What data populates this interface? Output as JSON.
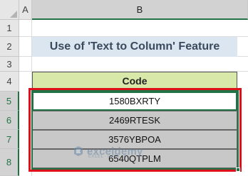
{
  "columns": [
    "A",
    "B"
  ],
  "rows": [
    "1",
    "2",
    "3",
    "4",
    "5",
    "6",
    "7",
    "8"
  ],
  "title": "Use of 'Text to Column' Feature",
  "table": {
    "header": "Code",
    "cells": [
      "1580BXRTY",
      "2469RTESK",
      "3576YBPOA",
      "6540QTPLM"
    ]
  },
  "watermark": {
    "name": "exceldemy",
    "tagline": "EXCEL · DATA · BI"
  },
  "colors": {
    "selection": "#217346",
    "highlight_box": "#e0101a",
    "title_bg": "#dce6f1",
    "header_bg": "#d8e8a8",
    "shaded_row": "#c8c8c8"
  }
}
